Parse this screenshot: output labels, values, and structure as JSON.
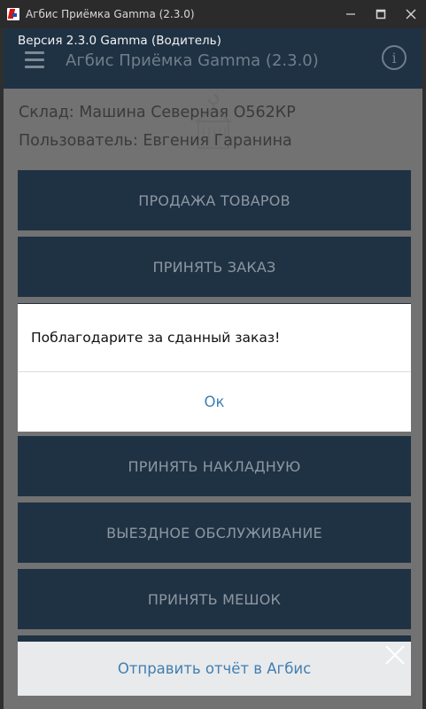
{
  "window": {
    "title": "Агбис Приёмка Gamma (2.3.0)",
    "minimize_glyph": "—",
    "maximize_glyph": "☐",
    "close_glyph": "✕"
  },
  "header": {
    "version": "Версия 2.3.0 Gamma (Водитель)",
    "title": "Агбис Приёмка Gamma (2.3.0)",
    "info_glyph": "i"
  },
  "info": {
    "warehouse": "Склад: Машина Северная О562КР",
    "user": "Пользователь: Евгения Гаранина"
  },
  "menu": {
    "sale": "ПРОДАЖА ТОВАРОВ",
    "accept_order": "ПРИНЯТЬ ЗАКАЗ",
    "accept_invoice": "ПРИНЯТЬ НАКЛАДНУЮ",
    "field_service": "ВЫЕЗДНОЕ ОБСЛУЖИВАНИЕ",
    "accept_bag": "ПРИНЯТЬ МЕШОК"
  },
  "dialog": {
    "message": "Поблагодарите за сданный заказ!",
    "ok_label": "Ок"
  },
  "bottom_bar": {
    "label": "Отправить отчёт в Агбис"
  },
  "colors": {
    "header_bg": "#1f3244",
    "button_bg": "#1f3244",
    "overlay_bg": "#727272",
    "link": "#3f7fb3"
  }
}
